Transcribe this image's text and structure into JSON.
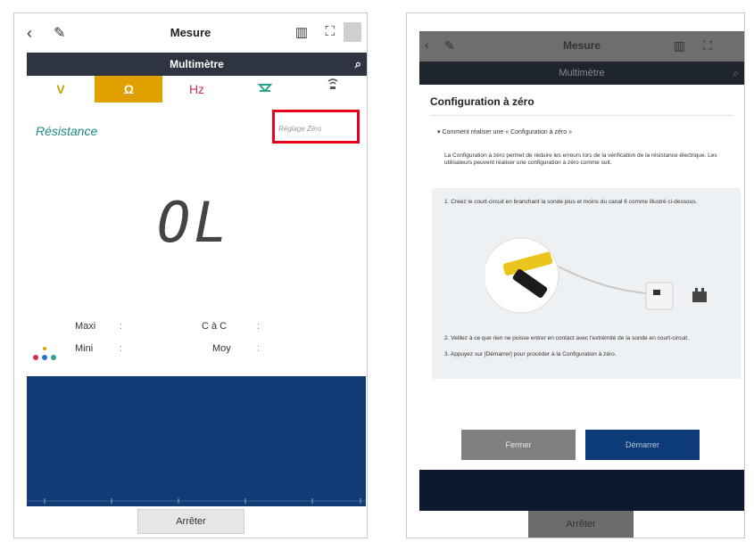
{
  "left": {
    "title": "Mesure",
    "subtitle": "Multimètre",
    "tabs": [
      "V",
      "Ω",
      "Hz",
      "",
      ""
    ],
    "active_tab": "Ω",
    "section_label": "Résistance",
    "zero_button": "Réglage Zéro",
    "reading": "OL",
    "stats": {
      "max": "Maxi",
      "min": "Mini",
      "ptp": "C à C",
      "avg": "Moy",
      "sep": ":"
    },
    "stop_button": "Arrêter",
    "colors": {
      "accent": "#e0a000",
      "highlight": "#e8001c",
      "chart_bg": "#123a74"
    }
  },
  "right": {
    "title": "Mesure",
    "subtitle": "Multimètre",
    "dialog": {
      "title": "Configuration à zéro",
      "question": "▾ Comment réaliser une « Configuration à zéro »",
      "paragraph": "La Configuration à zéro permet de réduire les erreurs lors de la vérification de la résistance électrique. Les utilisateurs peuvent réaliser une configuration à zéro comme suit.",
      "step1": "1. Créez le court-circuit en branchant la sonde plus et moins du canal 6 comme illustré ci-dessous.",
      "step2": "2. Veillez à ce que rien ne puisse entrer en contact avec l'extrémité de la sonde en court-circuit.",
      "step3": "3. Appuyez sur [Démarrer] pour procéder à la Configuration à zéro.",
      "close": "Fermer",
      "start": "Démarrer"
    },
    "stop_button": "Arrêter"
  }
}
